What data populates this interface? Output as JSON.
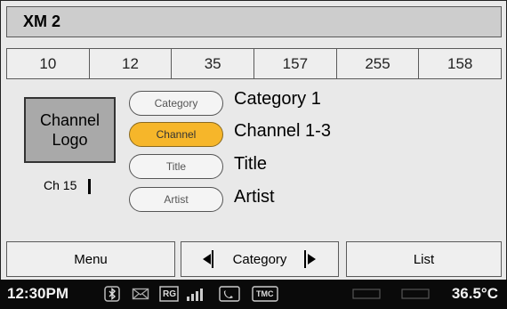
{
  "header": {
    "title": "XM 2"
  },
  "presets": [
    "10",
    "12",
    "35",
    "157",
    "255",
    "158"
  ],
  "logo": {
    "line1": "Channel",
    "line2": "Logo"
  },
  "channel_number": "Ch 15",
  "info_rows": [
    {
      "button": "Category",
      "value": "Category 1",
      "active": false
    },
    {
      "button": "Channel",
      "value": "Channel 1-3",
      "active": true
    },
    {
      "button": "Title",
      "value": "Title",
      "active": false
    },
    {
      "button": "Artist",
      "value": "Artist",
      "active": false
    }
  ],
  "bottom_bar": {
    "menu_label": "Menu",
    "category_label": "Category",
    "list_label": "List"
  },
  "status_bar": {
    "time": "12:30PM",
    "temperature": "36.5°C",
    "icons": [
      "bluetooth-icon",
      "message-icon",
      "rg-icon",
      "signal-icon",
      "phone-icon",
      "tmc-icon",
      "sat-icon",
      "mute-icon"
    ],
    "rg_text": "RG",
    "tmc_text": "TMC"
  },
  "colors": {
    "active_pill": "#f6b62a",
    "logo_box": "#a9a9a9",
    "status_bg": "#0a0a0a"
  }
}
